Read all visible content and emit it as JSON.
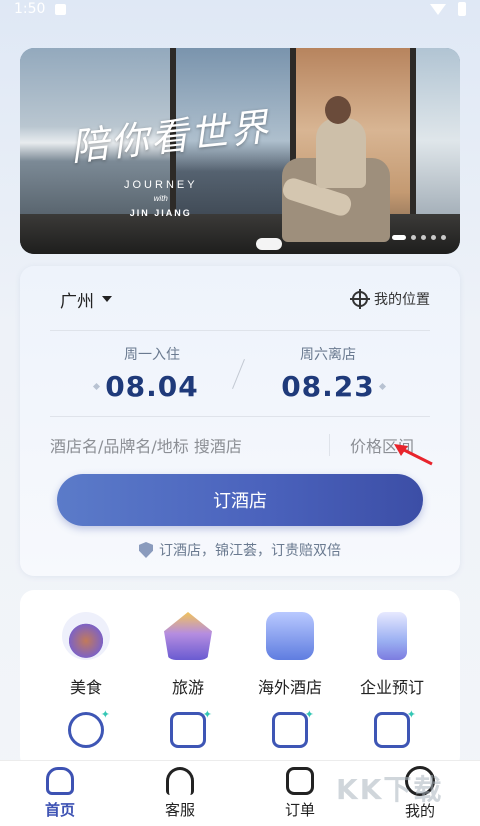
{
  "status_bar": {
    "time": "1:50"
  },
  "banner": {
    "title": "陪你看世界",
    "sub_line1": "JOURNEY",
    "sub_line2": "with",
    "sub_line3": "JIN JIANG",
    "page_count": 5,
    "active_page": 1
  },
  "booking": {
    "city": "广州",
    "my_location": "我的位置",
    "checkin_label": "周一入住",
    "checkin_date": "08.04",
    "checkout_label": "周六离店",
    "checkout_date": "08.23",
    "search_placeholder": "酒店名/品牌名/地标 搜酒店",
    "price_range": "价格区间",
    "book_button": "订酒店",
    "guarantee": "订酒店，锦江荟，订贵赔双倍"
  },
  "services": {
    "row1": [
      {
        "label": "美食",
        "icon": "food-icon"
      },
      {
        "label": "旅游",
        "icon": "travel-icon"
      },
      {
        "label": "海外酒店",
        "icon": "overseas-hotel-icon"
      },
      {
        "label": "企业预订",
        "icon": "business-booking-icon"
      }
    ],
    "row2_icons": [
      "clock-icon",
      "store-icon",
      "document-icon",
      "qr-code-icon"
    ]
  },
  "tabbar": {
    "items": [
      {
        "label": "首页",
        "icon": "home-icon",
        "active": true
      },
      {
        "label": "客服",
        "icon": "headset-icon",
        "active": false
      },
      {
        "label": "订单",
        "icon": "order-icon",
        "active": false
      },
      {
        "label": "我的",
        "icon": "user-icon",
        "active": false
      }
    ]
  },
  "watermark": "KK下载",
  "colors": {
    "accent": "#3d52b3",
    "date_text": "#1f3a7a",
    "annotation": "#e8242c"
  }
}
